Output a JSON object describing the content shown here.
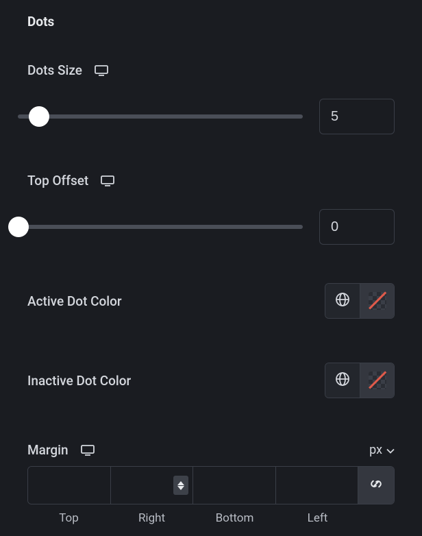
{
  "section": {
    "title": "Dots"
  },
  "dotsSize": {
    "label": "Dots Size",
    "value": "5",
    "thumbLeft": "16px"
  },
  "topOffset": {
    "label": "Top Offset",
    "value": "0",
    "thumbLeft": "0px"
  },
  "activeColor": {
    "label": "Active Dot Color"
  },
  "inactiveColor": {
    "label": "Inactive Dot Color"
  },
  "margin": {
    "label": "Margin",
    "unit": "px",
    "sides": {
      "top": "Top",
      "right": "Right",
      "bottom": "Bottom",
      "left": "Left"
    },
    "values": {
      "top": "",
      "right": "",
      "bottom": "",
      "left": ""
    }
  }
}
